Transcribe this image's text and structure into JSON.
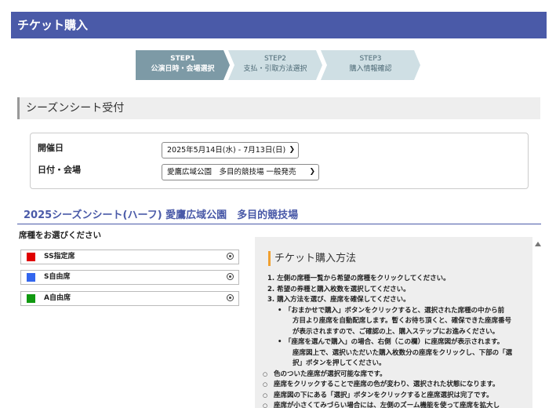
{
  "header": {
    "title": "チケット購入"
  },
  "steps": [
    {
      "num": "STEP1",
      "label": "公演日時・会場選択",
      "active": true
    },
    {
      "num": "STEP2",
      "label": "支払・引取方法選択",
      "active": false
    },
    {
      "num": "STEP3",
      "label": "購入情報確認",
      "active": false
    }
  ],
  "section": {
    "title": "シーズンシート受付"
  },
  "form": {
    "date_label": "開催日",
    "date_value": "2025年5月14日(水) - 7月13日(日)",
    "venue_label": "日付・会場",
    "venue_value": "愛鷹広域公園　多目的競技場 一般発売"
  },
  "season_title": "2025シーズンシート(ハーフ) 愛鷹広域公園　多目的競技場",
  "seat_heading": "席種をお選びください",
  "seats": [
    {
      "label": "SS指定席",
      "color": "#e00000"
    },
    {
      "label": "S自由席",
      "color": "#3366ee"
    },
    {
      "label": "A自由席",
      "color": "#119911"
    }
  ],
  "info": {
    "title": "チケット購入方法",
    "lines": [
      "1. 左側の席種一覧から希望の席種をクリックしてください。",
      "2. 希望の券種と購入枚数を選択してください。",
      "3. 購入方法を選び、座席を確保してください。",
      "「おまかせで購入」ボタンをクリックすると、選択された席種の中から前",
      "方目より座席を自動配席します。暫くお待ち頂くと、確保できた座席番号",
      "が表示されますので、ご確認の上、購入ステップにお進みください。",
      "「座席を選んで購入」の場合、右側（この欄）に座席図が表示されます。",
      "座席図上で、選択いただいた購入枚数分の座席をクリックし、下部の「選",
      "択」ボタンを押してください。",
      "色のついた座席が選択可能な席です。",
      "座席をクリックすることで座席の色が変わり、選択された状態になります。",
      "座席図の下にある「選択」ボタンをクリックすると座席選択は完了です。",
      "座席が小さくてみづらい場合には、左側のズーム機能を使って座席を拡大し"
    ]
  }
}
